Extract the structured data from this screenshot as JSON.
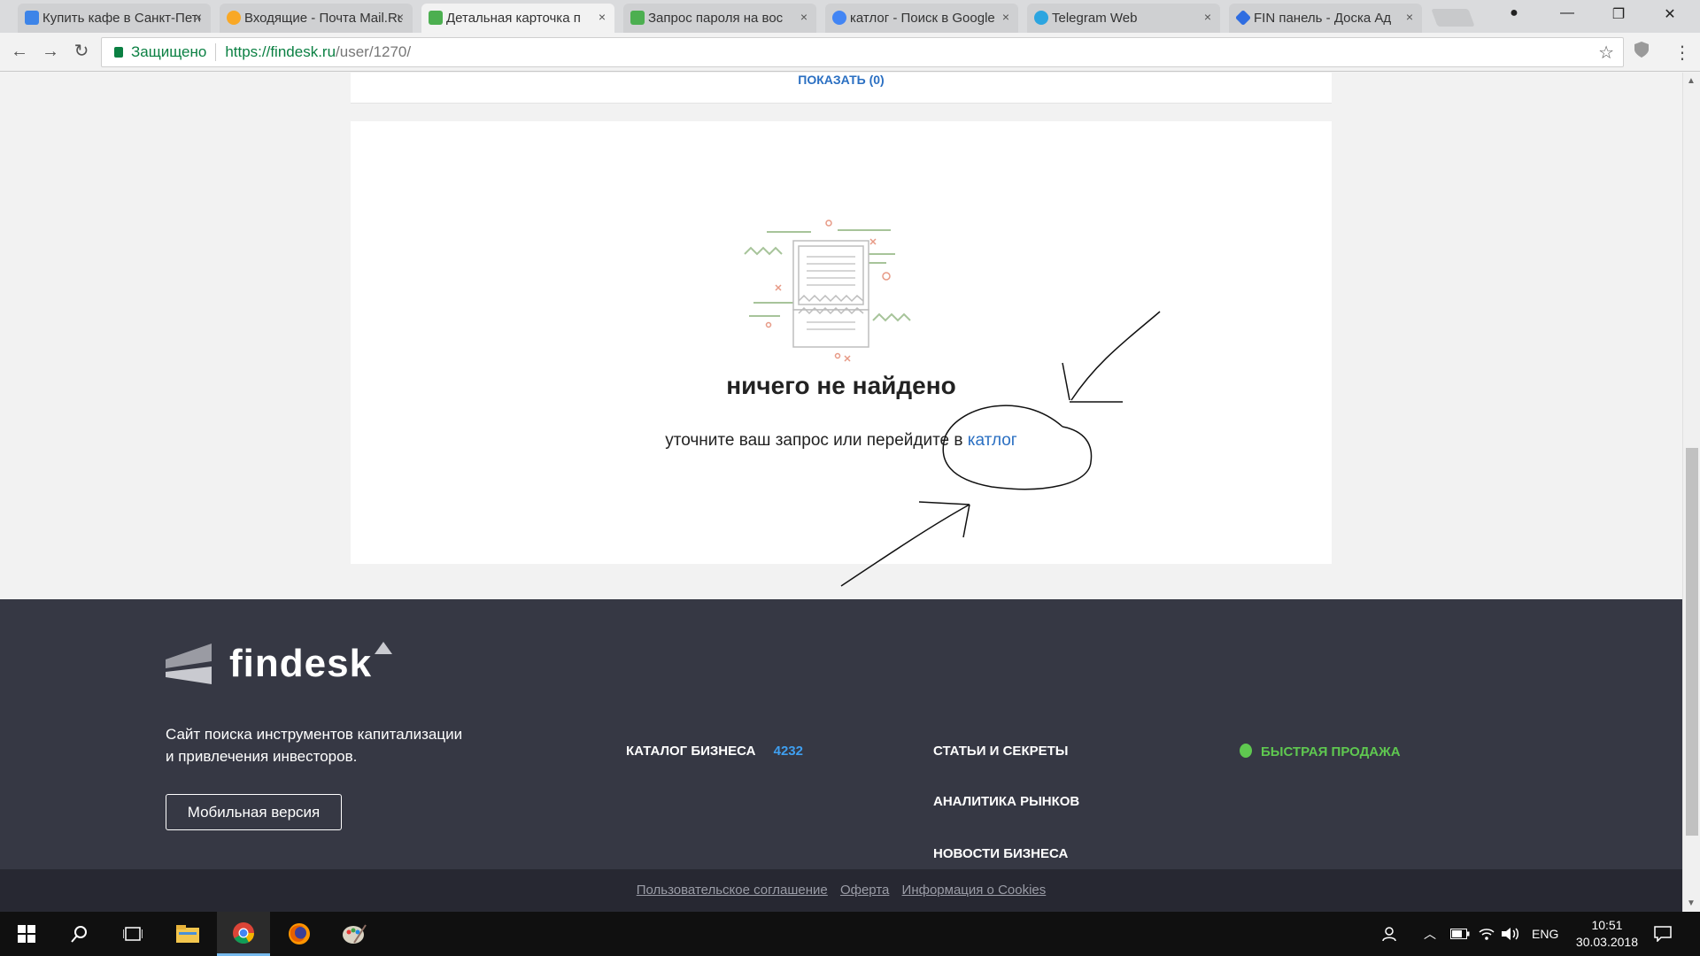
{
  "tabs": [
    {
      "title": "Купить кафе в Санкт-Петерб",
      "favicon_color": "#3d84e8"
    },
    {
      "title": "Входящие - Почта Mail.Ru",
      "favicon_color": "#f9a825"
    },
    {
      "title": "Детальная карточка п",
      "favicon_color": "#4caf50",
      "active": true
    },
    {
      "title": "Запрос пароля на вос",
      "favicon_color": "#4caf50"
    },
    {
      "title": "катлог - Поиск в Google",
      "favicon_color": "#4285f4"
    },
    {
      "title": "Telegram Web",
      "favicon_color": "#2ca5e0"
    },
    {
      "title": "FIN панель - Доска Ад",
      "favicon_color": "#2f6de1"
    }
  ],
  "tab_close_glyph": "×",
  "window_controls": {
    "minimize": "—",
    "restore": "❐",
    "close": "✕",
    "profile": "●"
  },
  "toolbar": {
    "back": "←",
    "forward": "→",
    "reload": "↻",
    "secure_label": "Защищено",
    "url_host": "https://findesk.ru",
    "url_path": "/user/1270/",
    "bookmark_star": "☆"
  },
  "page": {
    "show_link": "ПОКАЗАТЬ (0)",
    "empty_title": "ничего не найдено",
    "empty_text": "уточните ваш запрос или перейдите в",
    "empty_link": "катлог"
  },
  "footer": {
    "logo_text": "findesk",
    "description_line1": "Сайт поиска инструментов капитализации",
    "description_line2": "и привлечения инвесторов.",
    "mobile_button": "Мобильная версия",
    "nav": {
      "catalog": "КАТАЛОГ БИЗНЕСА",
      "catalog_count": "4232",
      "articles": "СТАТЬИ И СЕКРЕТЫ",
      "analytics": "АНАЛИТИКА РЫНКОВ",
      "news": "НОВОСТИ БИЗНЕСА",
      "quick_sale": "БЫСТРАЯ ПРОДАЖА"
    },
    "legal": [
      "Пользовательское соглашение",
      "Оферта",
      "Информация о Cookies"
    ]
  },
  "taskbar": {
    "language": "ENG",
    "time": "10:51",
    "date": "30.03.2018"
  },
  "colors": {
    "link_blue": "#2a6fc2",
    "footer_bg": "#363844",
    "green_accent": "#5fc850",
    "count_blue": "#3f9ff0"
  }
}
